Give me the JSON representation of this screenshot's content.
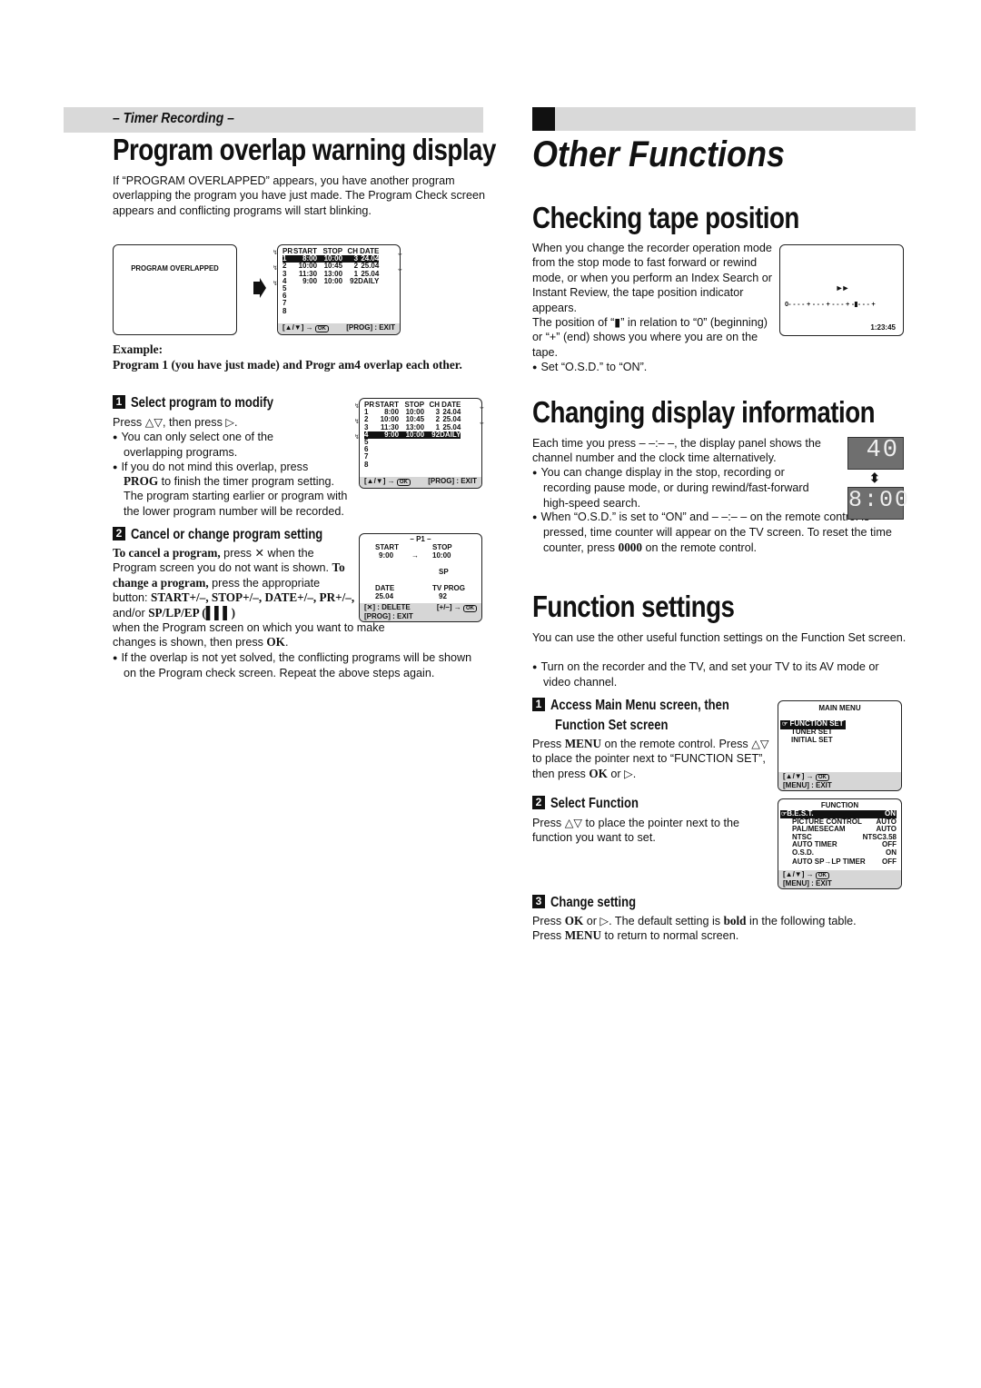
{
  "left": {
    "section_tag": "– Timer Recording –",
    "title": "Program overlap warning display",
    "intro": "If “PROGRAM OVERLAPPED” appears, you have another program overlapping the program you have just made. The Program Check screen appears and conflicting programs will start blinking.",
    "overlap_screen_text": "PROGRAM OVERLAPPED",
    "arrow_icon": "right-arrow",
    "program_check_1": {
      "headers": [
        "PR",
        "START",
        "STOP",
        "CH",
        "DATE"
      ],
      "rows": [
        [
          "1",
          "8:00",
          "10:00",
          "3",
          "24.04"
        ],
        [
          "2",
          "10:00",
          "10:45",
          "2",
          "25.04"
        ],
        [
          "3",
          "11:30",
          "13:00",
          "1",
          "25.04"
        ],
        [
          "4",
          "9:00",
          "10:00",
          "92",
          "DAILY"
        ],
        [
          "5",
          "",
          "",
          "",
          ""
        ],
        [
          "6",
          "",
          "",
          "",
          ""
        ],
        [
          "7",
          "",
          "",
          "",
          ""
        ],
        [
          "8",
          "",
          "",
          "",
          ""
        ]
      ],
      "highlighted_row": 1,
      "footer_left": "[▲/▼] →",
      "footer_ok": "OK",
      "footer_right": "[PROG] : EXIT"
    },
    "example_label": "Example:",
    "example_text": "Program 1 (you have just made) and Progr am4 overlap each other.",
    "step1": {
      "num": "1",
      "title": "Select program to modify",
      "line1": "Press △▽, then press ▷.",
      "bullets": [
        "You can only select one of the overlapping programs.",
        "If you do not mind this overlap, press"
      ],
      "prog_bold": "PROG",
      "bullet2_rest": " to finish the timer program setting. The program starting earlier or program with the lower program number will be recorded."
    },
    "program_check_2": {
      "headers": [
        "PR",
        "START",
        "STOP",
        "CH",
        "DATE"
      ],
      "rows": [
        [
          "1",
          "8:00",
          "10:00",
          "3",
          "24.04"
        ],
        [
          "2",
          "10:00",
          "10:45",
          "2",
          "25.04"
        ],
        [
          "3",
          "11:30",
          "13:00",
          "1",
          "25.04"
        ],
        [
          "4",
          "9:00",
          "10:00",
          "92",
          "DAILY"
        ],
        [
          "5",
          "",
          "",
          "",
          ""
        ],
        [
          "6",
          "",
          "",
          "",
          ""
        ],
        [
          "7",
          "",
          "",
          "",
          ""
        ],
        [
          "8",
          "",
          "",
          "",
          ""
        ]
      ],
      "highlighted_row": 4,
      "footer_left": "[▲/▼] →",
      "footer_ok": "OK",
      "footer_right": "[PROG] : EXIT"
    },
    "step2": {
      "num": "2",
      "title": "Cancel or change program setting",
      "cancel_bold": "To cancel a program,",
      "cancel_rest": " press ✕ when the Program screen you do not want is shown.",
      "change_bold": "To change a program,",
      "change_rest": " press the appropriate button: ",
      "buttons_bold_1": "START+/–, STOP+/–, DATE+/–, PR+/–,",
      "and_or": " and/or ",
      "buttons_bold_2": "SP/LP/EP (▌▌▌)",
      "change_tail": " when the Program screen on which you want to make changes is shown, then press ",
      "ok_bold": "OK",
      "bullet": "If the overlap is not yet solved, the conflicting programs will be shown on the Program check screen. Repeat the above steps again."
    },
    "p1_screen": {
      "title": "– P1 –",
      "start_label": "START",
      "start_value": "9:00",
      "arrow": "→",
      "stop_label": "STOP",
      "stop_value": "10:00",
      "mode": "SP",
      "date_label": "DATE",
      "date_value": "25.04",
      "tvprog_label": "TV PROG",
      "tvprog_value": "92",
      "delete": "[✕] : DELETE",
      "adjust": "[+/–] →",
      "ok": "OK",
      "exit": "[PROG] : EXIT"
    }
  },
  "right": {
    "chapter_title": "Other Functions",
    "tape": {
      "title": "Checking tape position",
      "para": "When you change the recorder operation mode from the stop mode to fast forward or rewind mode, or when you perform an Index Search or Instant Review, the tape position indicator appears.",
      "para2": "The position of “▮” in relation to “0” (beginning) or “+” (end) shows you where you are on the tape.",
      "bullet": "Set “O.S.D.” to “ON”.",
      "screen": {
        "mode_icon": "►►",
        "scale": "0- - - - + - - - + - - - + -▮- - - +",
        "counter": "1:23:45"
      }
    },
    "display": {
      "title": "Changing display information",
      "para": "Each time you press – –:– –, the display panel shows the channel number and the clock time alternatively.",
      "bullet1": "You can change display in the stop, recording or recording pause mode, or during rewind/fast-forward high-speed search.",
      "bullet2_a": "When “O.S.D.” is set to “ON” and – –:– – on the remote control is pressed, time counter will appear on the TV screen. To reset the time counter, press ",
      "bullet2_bold": "0000",
      "bullet2_b": " on the remote control.",
      "lcd_channel": "40",
      "lcd_clock": "8:00",
      "swap_icon": "⬍"
    },
    "function": {
      "title": "Function settings",
      "para": "You can use the other useful function settings on the Function Set screen.",
      "bullet": "Turn on the recorder and the TV, and set your TV to its AV mode or video channel.",
      "step1": {
        "num": "1",
        "title_line1": "Access Main Menu screen, then",
        "title_line2": "Function Set screen",
        "t1": "Press ",
        "menu_bold": "MENU",
        "t2": " on the remote control. Press △▽ to place the pointer next to “FUNCTION SET”, then press ",
        "ok_bold": "OK",
        "t3": " or ▷."
      },
      "main_menu": {
        "title": "MAIN MENU",
        "items": [
          "FUNCTION SET",
          "TUNER SET",
          "INITIAL SET"
        ],
        "selected": 0,
        "nav": "[▲/▼] →",
        "ok": "OK",
        "exit": "[MENU] : EXIT"
      },
      "step2": {
        "num": "2",
        "title": "Select Function",
        "text": "Press △▽ to place the pointer next to the function you want to set."
      },
      "function_menu": {
        "title": "FUNCTION",
        "items": [
          {
            "label": "B.E.S.T.",
            "value": "ON"
          },
          {
            "label": "PICTURE CONTROL",
            "value": "AUTO"
          },
          {
            "label": "PAL/MESECAM",
            "value": "AUTO"
          },
          {
            "label": "NTSC",
            "value": "NTSC3.58"
          },
          {
            "label": "AUTO TIMER",
            "value": "OFF"
          },
          {
            "label": "O.S.D.",
            "value": "ON"
          },
          {
            "label": "AUTO SP→LP TIMER",
            "value": "OFF"
          }
        ],
        "selected": 0,
        "nav": "[▲/▼] →",
        "ok": "OK",
        "exit": "[MENU] : EXIT"
      },
      "step3": {
        "num": "3",
        "title": "Change setting",
        "t1": "Press ",
        "ok_bold": "OK",
        "t2": " or ▷. The default setting is ",
        "bold_word": "bold",
        "t3": " in the following table.",
        "t4": "Press ",
        "menu_bold": "MENU",
        "t5": " to return to normal screen."
      }
    }
  }
}
